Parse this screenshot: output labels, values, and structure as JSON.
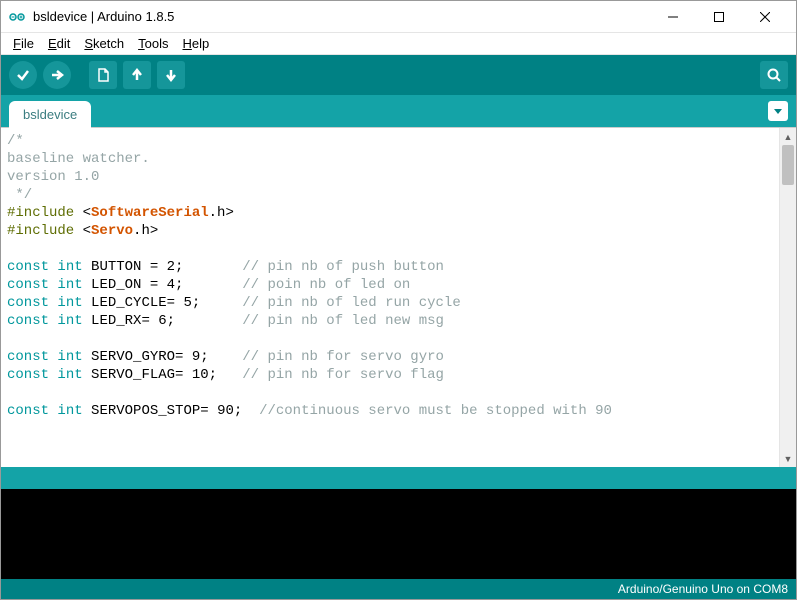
{
  "window": {
    "title": "bsldevice | Arduino 1.8.5"
  },
  "menu": {
    "file": {
      "label": "File",
      "mnemonic_pos": 0
    },
    "edit": {
      "label": "Edit",
      "mnemonic_pos": 0
    },
    "sketch": {
      "label": "Sketch",
      "mnemonic_pos": 0
    },
    "tools": {
      "label": "Tools",
      "mnemonic_pos": 0
    },
    "help": {
      "label": "Help",
      "mnemonic_pos": 0
    }
  },
  "toolbar": {
    "verify_icon": "check",
    "upload_icon": "arrow-right",
    "new_icon": "file",
    "open_icon": "arrow-up",
    "save_icon": "arrow-down",
    "serial_icon": "magnifier"
  },
  "tabs": {
    "active": "bsldevice"
  },
  "editor": {
    "lines": [
      {
        "segments": [
          {
            "cls": "cmt",
            "text": "/*"
          }
        ]
      },
      {
        "segments": [
          {
            "cls": "cmt",
            "text": "baseline watcher."
          }
        ]
      },
      {
        "segments": [
          {
            "cls": "cmt",
            "text": "version 1.0"
          }
        ]
      },
      {
        "segments": [
          {
            "cls": "cmt",
            "text": " */"
          }
        ]
      },
      {
        "segments": [
          {
            "cls": "pp",
            "text": "#include"
          },
          {
            "cls": "",
            "text": " <"
          },
          {
            "cls": "lib",
            "text": "SoftwareSerial"
          },
          {
            "cls": "",
            "text": ".h>"
          }
        ]
      },
      {
        "segments": [
          {
            "cls": "pp",
            "text": "#include"
          },
          {
            "cls": "",
            "text": " <"
          },
          {
            "cls": "lib",
            "text": "Servo"
          },
          {
            "cls": "",
            "text": ".h>"
          }
        ]
      },
      {
        "segments": [
          {
            "cls": "",
            "text": ""
          }
        ]
      },
      {
        "segments": [
          {
            "cls": "kw",
            "text": "const"
          },
          {
            "cls": "",
            "text": " "
          },
          {
            "cls": "kw",
            "text": "int"
          },
          {
            "cls": "",
            "text": " BUTTON = 2;       "
          },
          {
            "cls": "cmt",
            "text": "// pin nb of push button"
          }
        ]
      },
      {
        "segments": [
          {
            "cls": "kw",
            "text": "const"
          },
          {
            "cls": "",
            "text": " "
          },
          {
            "cls": "kw",
            "text": "int"
          },
          {
            "cls": "",
            "text": " LED_ON = 4;       "
          },
          {
            "cls": "cmt",
            "text": "// poin nb of led on"
          }
        ]
      },
      {
        "segments": [
          {
            "cls": "kw",
            "text": "const"
          },
          {
            "cls": "",
            "text": " "
          },
          {
            "cls": "kw",
            "text": "int"
          },
          {
            "cls": "",
            "text": " LED_CYCLE= 5;     "
          },
          {
            "cls": "cmt",
            "text": "// pin nb of led run cycle"
          }
        ]
      },
      {
        "segments": [
          {
            "cls": "kw",
            "text": "const"
          },
          {
            "cls": "",
            "text": " "
          },
          {
            "cls": "kw",
            "text": "int"
          },
          {
            "cls": "",
            "text": " LED_RX= 6;        "
          },
          {
            "cls": "cmt",
            "text": "// pin nb of led new msg"
          }
        ]
      },
      {
        "segments": [
          {
            "cls": "",
            "text": ""
          }
        ]
      },
      {
        "segments": [
          {
            "cls": "kw",
            "text": "const"
          },
          {
            "cls": "",
            "text": " "
          },
          {
            "cls": "kw",
            "text": "int"
          },
          {
            "cls": "",
            "text": " SERVO_GYRO= 9;    "
          },
          {
            "cls": "cmt",
            "text": "// pin nb for servo gyro"
          }
        ]
      },
      {
        "segments": [
          {
            "cls": "kw",
            "text": "const"
          },
          {
            "cls": "",
            "text": " "
          },
          {
            "cls": "kw",
            "text": "int"
          },
          {
            "cls": "",
            "text": " SERVO_FLAG= 10;   "
          },
          {
            "cls": "cmt",
            "text": "// pin nb for servo flag"
          }
        ]
      },
      {
        "segments": [
          {
            "cls": "",
            "text": ""
          }
        ]
      },
      {
        "segments": [
          {
            "cls": "kw",
            "text": "const"
          },
          {
            "cls": "",
            "text": " "
          },
          {
            "cls": "kw",
            "text": "int"
          },
          {
            "cls": "",
            "text": " SERVOPOS_STOP= 90;  "
          },
          {
            "cls": "cmt",
            "text": "//continuous servo must be stopped with 90"
          }
        ]
      }
    ]
  },
  "footer": {
    "board": "Arduino/Genuino Uno on COM8"
  }
}
